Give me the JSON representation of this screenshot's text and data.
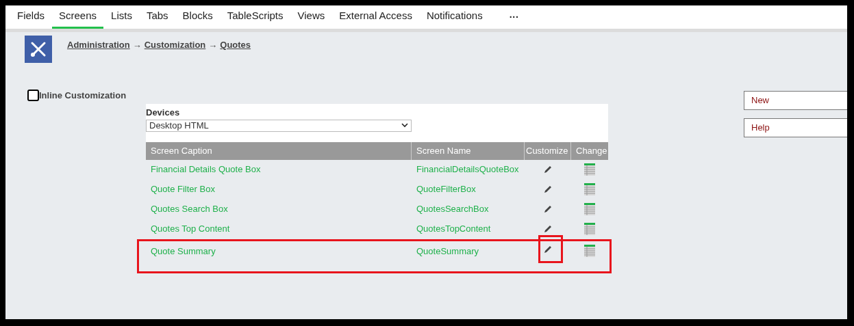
{
  "tabs": [
    {
      "label": "Fields",
      "selected": false
    },
    {
      "label": "Screens",
      "selected": true
    },
    {
      "label": "Lists",
      "selected": false
    },
    {
      "label": "Tabs",
      "selected": false
    },
    {
      "label": "Blocks",
      "selected": false
    },
    {
      "label": "TableScripts",
      "selected": false
    },
    {
      "label": "Views",
      "selected": false
    },
    {
      "label": "External Access",
      "selected": false
    },
    {
      "label": "Notifications",
      "selected": false
    }
  ],
  "more_tabs": "···",
  "breadcrumb": [
    "Administration",
    "Customization",
    "Quotes"
  ],
  "breadcrumb_separator": "→",
  "inline_customization": {
    "label": "Inline Customization",
    "checked": false
  },
  "devices": {
    "label": "Devices",
    "value": "Desktop HTML"
  },
  "table": {
    "columns": [
      "Screen Caption",
      "Screen Name",
      "Customize",
      "Change"
    ],
    "rows": [
      {
        "caption": "Financial Details Quote Box",
        "name": "FinancialDetailsQuoteBox",
        "highlighted": false
      },
      {
        "caption": "Quote Filter Box",
        "name": "QuoteFilterBox",
        "highlighted": false
      },
      {
        "caption": "Quotes Search Box",
        "name": "QuotesSearchBox",
        "highlighted": false
      },
      {
        "caption": "Quotes Top Content",
        "name": "QuotesTopContent",
        "highlighted": false
      },
      {
        "caption": "Quote Summary",
        "name": "QuoteSummary",
        "highlighted": true
      }
    ]
  },
  "buttons": [
    "New",
    "Help"
  ]
}
